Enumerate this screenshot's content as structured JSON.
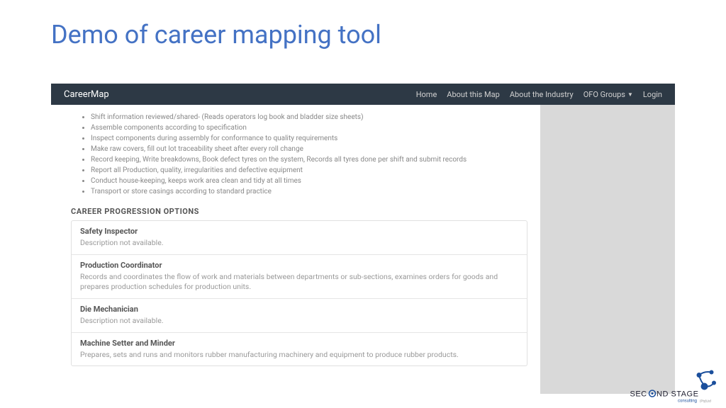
{
  "slide": {
    "title": "Demo of career mapping tool"
  },
  "navbar": {
    "brand": "CareerMap",
    "items": [
      {
        "label": "Home"
      },
      {
        "label": "About this Map"
      },
      {
        "label": "About the Industry"
      },
      {
        "label": "OFO Groups",
        "dropdown": true
      },
      {
        "label": "Login"
      }
    ]
  },
  "bullets": [
    "Shift information reviewed/shared- (Reads operators log book and bladder size sheets)",
    "Assemble components according to specification",
    "Inspect components during assembly for conformance to quality requirements",
    "Make raw covers, fill out lot traceability sheet after every roll change",
    "Record keeping, Write breakdowns, Book defect tyres on the system, Records all tyres done per shift and submit records",
    "Report all Production, quality, irregularities and defective equipment",
    "Conduct house-keeping, keeps work area clean and tidy at all times",
    "Transport or store casings according to standard practice"
  ],
  "section": {
    "heading": "CAREER PROGRESSION OPTIONS"
  },
  "cards": [
    {
      "title": "Safety Inspector",
      "desc": "Description not available."
    },
    {
      "title": "Production Coordinator",
      "desc": "Records and coordinates the flow of work and materials between departments or sub-sections, examines orders for goods and prepares production schedules for production units."
    },
    {
      "title": "Die Mechanician",
      "desc": "Description not available."
    },
    {
      "title": "Machine Setter and Minder",
      "desc": "Prepares, sets and runs and monitors rubber manufacturing machinery and equipment to produce rubber products."
    }
  ],
  "logo": {
    "line1": "SECOND STAGE",
    "line2": "consulting",
    "suffix": "(Pty)Ltd"
  }
}
